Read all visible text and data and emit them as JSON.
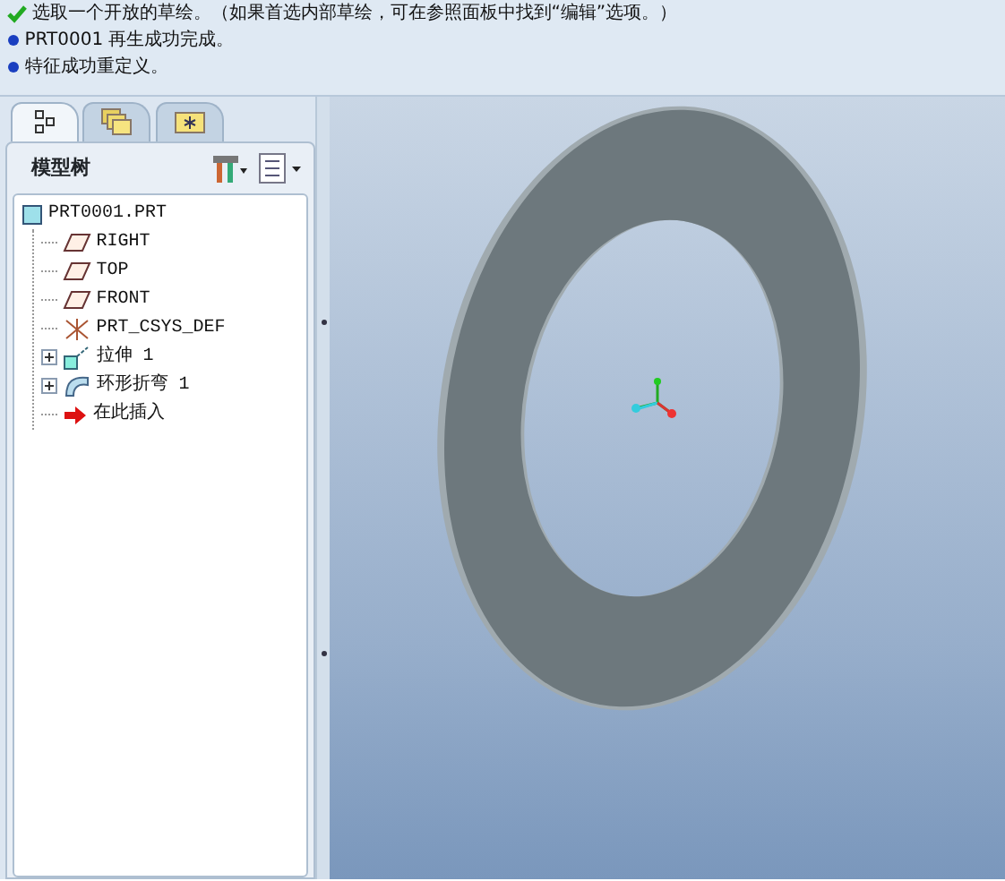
{
  "messages": [
    {
      "kind": "ok",
      "text": "选取一个开放的草绘。（如果首选内部草绘，可在参照面板中找到“编辑”选项。）"
    },
    {
      "kind": "info",
      "text": "PRT0001 再生成功完成。"
    },
    {
      "kind": "info",
      "text": "特征成功重定义。"
    }
  ],
  "navigator_tabs": [
    {
      "kind": "tree",
      "selected": true
    },
    {
      "kind": "folders",
      "selected": false
    },
    {
      "kind": "favorites",
      "selected": false
    }
  ],
  "model_tree": {
    "title": "模型树",
    "root": {
      "label": "PRT0001.PRT",
      "kind": "part",
      "children": [
        {
          "label": "RIGHT",
          "kind": "plane"
        },
        {
          "label": "TOP",
          "kind": "plane"
        },
        {
          "label": "FRONT",
          "kind": "plane"
        },
        {
          "label": "PRT_CSYS_DEF",
          "kind": "csys"
        },
        {
          "label": "拉伸 1",
          "kind": "extrude",
          "expanded": false
        },
        {
          "label": "环形折弯 1",
          "kind": "bend",
          "expanded": false
        },
        {
          "label": "在此插入",
          "kind": "insert"
        }
      ]
    }
  }
}
